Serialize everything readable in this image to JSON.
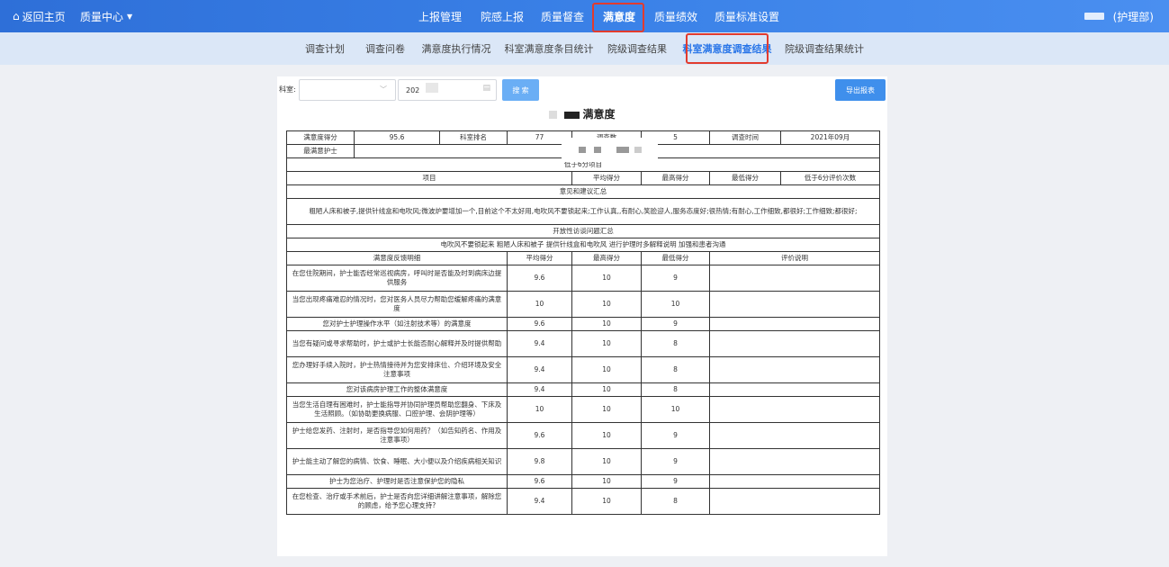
{
  "topbar": {
    "home_label": "返回主页",
    "quality_center": "质量中心",
    "nav_items": [
      "上报管理",
      "院感上报",
      "质量督查",
      "满意度",
      "质量绩效",
      "质量标准设置"
    ],
    "active_nav": "满意度",
    "user_label": "(护理部)"
  },
  "subnav": {
    "items": [
      "调查计划",
      "调查问卷",
      "满意度执行情况",
      "科室满意度条目统计",
      "院级调查结果",
      "科室满意度调查结果",
      "院级调查结果统计"
    ],
    "active": "科室满意度调查结果"
  },
  "filter": {
    "dept_label": "科室:",
    "date_value": "202",
    "search_button": "搜 索",
    "export_button": "导出报表"
  },
  "report": {
    "title": "满意度",
    "summary": {
      "score_label": "满意度得分",
      "score": "95.6",
      "rank_label": "科室排名",
      "rank": "77",
      "survey_count_label": "调查数",
      "survey_count": "5",
      "survey_time_label": "调查时间",
      "survey_time": "2021年09月",
      "best_nurse_label": "最满意护士"
    },
    "low_section": {
      "title": "低于6分项目",
      "headers": [
        "项目",
        "平均得分",
        "最高得分",
        "最低得分",
        "低于6分评价次数"
      ]
    },
    "opinion_section": {
      "title": "意见和建议汇总",
      "text": "粗陋人床和被子,提供针线盒和电吹风;微波炉要增加一个,目前这个不太好用,电吹风不要锁起来;工作认真,,有耐心,笑脸迎人,服务态度好;很热情;有耐心,工作细致,都很好;工作细致;都很好;"
    },
    "open_section": {
      "title": "开放性访谈问题汇总",
      "text": "电吹风不要锁起来 粗陋人床和被子 提供针线盒和电吹风 进行护理时多解释说明 加强和患者沟通"
    },
    "detail_headers": [
      "满意度反馈明细",
      "平均得分",
      "最高得分",
      "最低得分",
      "评价说明"
    ],
    "detail_rows": [
      {
        "item": "在您住院期间，护士能否经常巡视病房，呼叫时是否能及时到病床边提供服务",
        "avg": "9.6",
        "max": "10",
        "min": "9",
        "note": ""
      },
      {
        "item": "当您出现疼痛难忍的情况时，您对医务人员尽力帮助您缓解疼痛的满意度",
        "avg": "10",
        "max": "10",
        "min": "10",
        "note": ""
      },
      {
        "item": "您对护士护理操作水平（如注射技术等）的满意度",
        "avg": "9.6",
        "max": "10",
        "min": "9",
        "note": ""
      },
      {
        "item": "当您有疑问或寻求帮助时，护士或护士长能否耐心解释并及时提供帮助",
        "avg": "9.4",
        "max": "10",
        "min": "8",
        "note": ""
      },
      {
        "item": "您办理好手续入院时，护士热情接待并为您安排床位、介绍环境及安全注意事项",
        "avg": "9.4",
        "max": "10",
        "min": "8",
        "note": ""
      },
      {
        "item": "您对该病房护理工作的整体满意度",
        "avg": "9.4",
        "max": "10",
        "min": "8",
        "note": ""
      },
      {
        "item": "当您生活自理有困难时，护士能指导并协同护理员帮助您翻身、下床及生活照顾。（如协助更换病服、口腔护理、会阴护理等）",
        "avg": "10",
        "max": "10",
        "min": "10",
        "note": ""
      },
      {
        "item": "护士给您发药、注射时，是否指导您如何用药？（如告知药名、作用及注意事项）",
        "avg": "9.6",
        "max": "10",
        "min": "9",
        "note": ""
      },
      {
        "item": "护士能主动了解您的病情、饮食、睡眠、大小便以及介绍疾病相关知识",
        "avg": "9.8",
        "max": "10",
        "min": "9",
        "note": ""
      },
      {
        "item": "护士为您治疗、护理时是否注意保护您的隐私",
        "avg": "9.6",
        "max": "10",
        "min": "9",
        "note": ""
      },
      {
        "item": "在您检查、治疗或手术前后，护士是否向您详细讲解注意事项，解除您的顾虑，给予您心理支持?",
        "avg": "9.4",
        "max": "10",
        "min": "8",
        "note": ""
      }
    ]
  },
  "colors": {
    "topbar": "#3b82e8",
    "subnav_bg": "#dbe7f7",
    "active_sub": "#2a76e8",
    "highlight_box": "#e23b2e",
    "search_btn": "#6aaef5",
    "export_btn": "#3f8fec"
  },
  "icons": [
    "home-icon",
    "caret-down-icon",
    "chevron-down-icon",
    "calendar-icon"
  ]
}
